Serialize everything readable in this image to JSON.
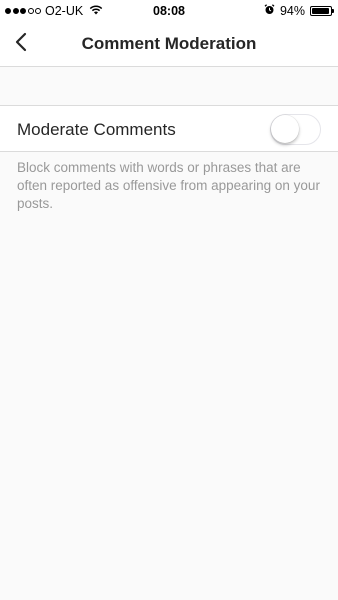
{
  "status_bar": {
    "carrier": "O2-UK",
    "time": "08:08",
    "battery_percent": "94%",
    "battery_level": 0.94,
    "signal_bars_filled": 3,
    "signal_bars_total": 5,
    "icons": [
      "signal-dots-icon",
      "wifi-icon",
      "alarm-icon",
      "battery-icon"
    ]
  },
  "nav": {
    "title": "Comment Moderation",
    "back_icon": "chevron-left-icon"
  },
  "setting": {
    "label": "Moderate Comments",
    "enabled": false,
    "help_text": "Block comments with words or phrases that are often reported as offensive from appearing on your posts."
  },
  "colors": {
    "background": "#fafafa",
    "divider": "#dbdbdb",
    "text": "#262626",
    "secondary_text": "#999999"
  }
}
